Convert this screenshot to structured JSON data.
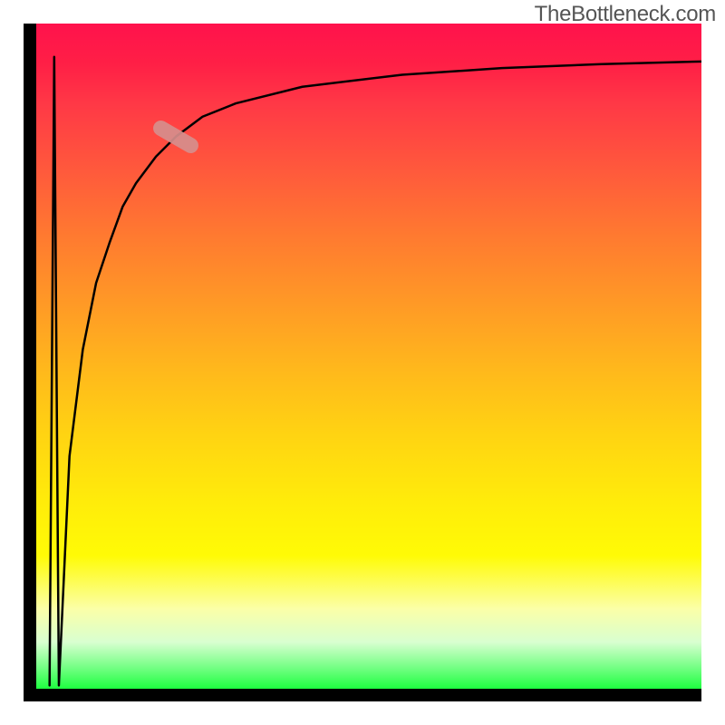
{
  "watermark": "TheBottleneck.com",
  "chart_data": {
    "type": "line",
    "title": "",
    "xlabel": "",
    "ylabel": "",
    "xlim": [
      0,
      100
    ],
    "ylim": [
      0,
      100
    ],
    "background_gradient": {
      "direction": "vertical",
      "stops": [
        {
          "pos": 0.0,
          "color": "#ff124c"
        },
        {
          "pos": 0.5,
          "color": "#ffb81c"
        },
        {
          "pos": 0.8,
          "color": "#fffb06"
        },
        {
          "pos": 1.0,
          "color": "#1eff40"
        }
      ]
    },
    "series": [
      {
        "name": "left-spike",
        "x": [
          2.0,
          2.7,
          3.4
        ],
        "y": [
          99.5,
          5,
          99.5
        ]
      },
      {
        "name": "main-curve",
        "x": [
          3.4,
          5,
          7,
          9,
          11,
          13,
          15,
          18,
          21,
          25,
          30,
          40,
          55,
          70,
          85,
          100
        ],
        "y": [
          99.5,
          65,
          49,
          39,
          33,
          27.5,
          24,
          20,
          17,
          14,
          12,
          9.5,
          7.7,
          6.7,
          6.1,
          5.7
        ]
      }
    ],
    "marker": {
      "series": "main-curve",
      "x": 21,
      "y": 17,
      "rotation_deg": 30
    },
    "frame_color": "#000000"
  }
}
